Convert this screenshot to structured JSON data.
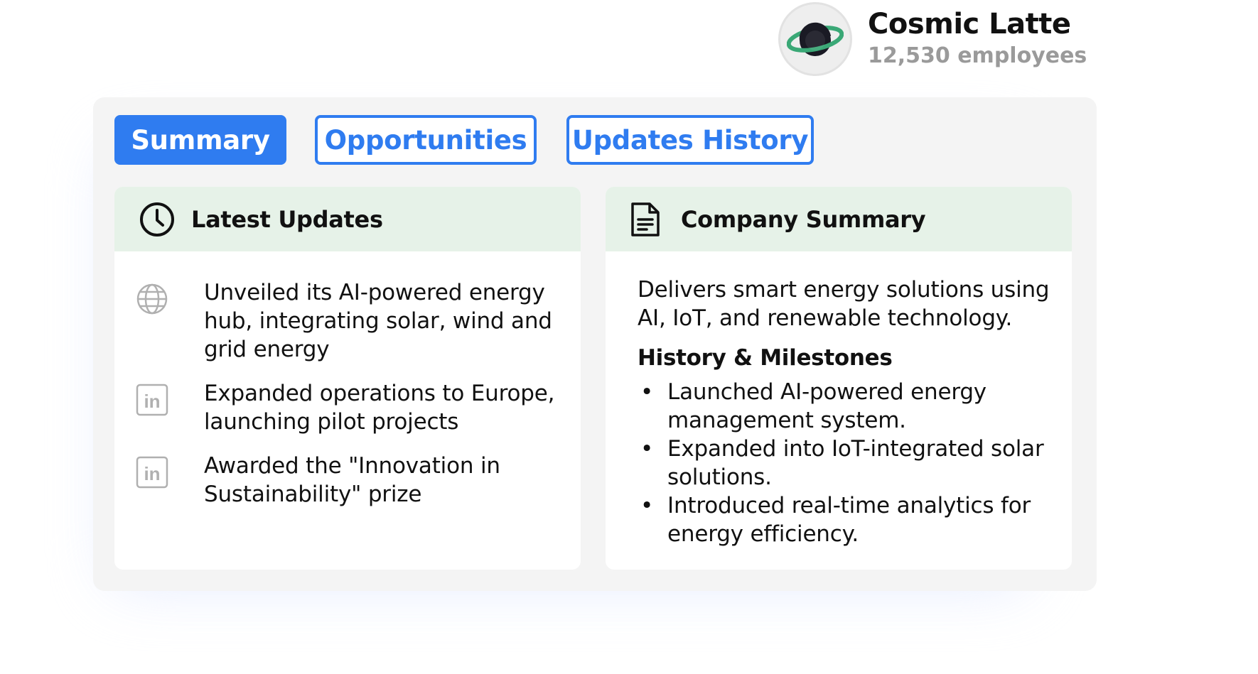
{
  "company": {
    "name": "Cosmic Latte",
    "employees": "12,530 employees"
  },
  "tabs": [
    {
      "label": "Summary",
      "active": true
    },
    {
      "label": "Opportunities",
      "active": false
    },
    {
      "label": "Updates History",
      "active": false
    }
  ],
  "latest_updates": {
    "title": "Latest Updates",
    "icon": "clock-icon",
    "items": [
      {
        "icon": "globe-icon",
        "text": "Unveiled its  AI-powered energy hub, integrating solar, wind and grid energy"
      },
      {
        "icon": "linkedin-icon",
        "text": "Expanded operations to Europe, launching pilot projects"
      },
      {
        "icon": "linkedin-icon",
        "text": "Awarded the \"Innovation in Sustainability\" prize"
      }
    ]
  },
  "company_summary": {
    "title": "Company Summary",
    "icon": "document-icon",
    "description": "Delivers smart energy solutions using AI, IoT, and renewable technology.",
    "milestones_title": "History & Milestones",
    "milestones": [
      "Launched AI-powered energy management system.",
      "Expanded into IoT-integrated solar solutions.",
      "Introduced real-time analytics for energy efficiency."
    ]
  },
  "colors": {
    "accent": "#2f7cf0",
    "card_header": "#e6f2e8",
    "panel": "#f4f4f4",
    "muted_text": "#9a9a9a",
    "logo_ring": "#3aa876"
  }
}
